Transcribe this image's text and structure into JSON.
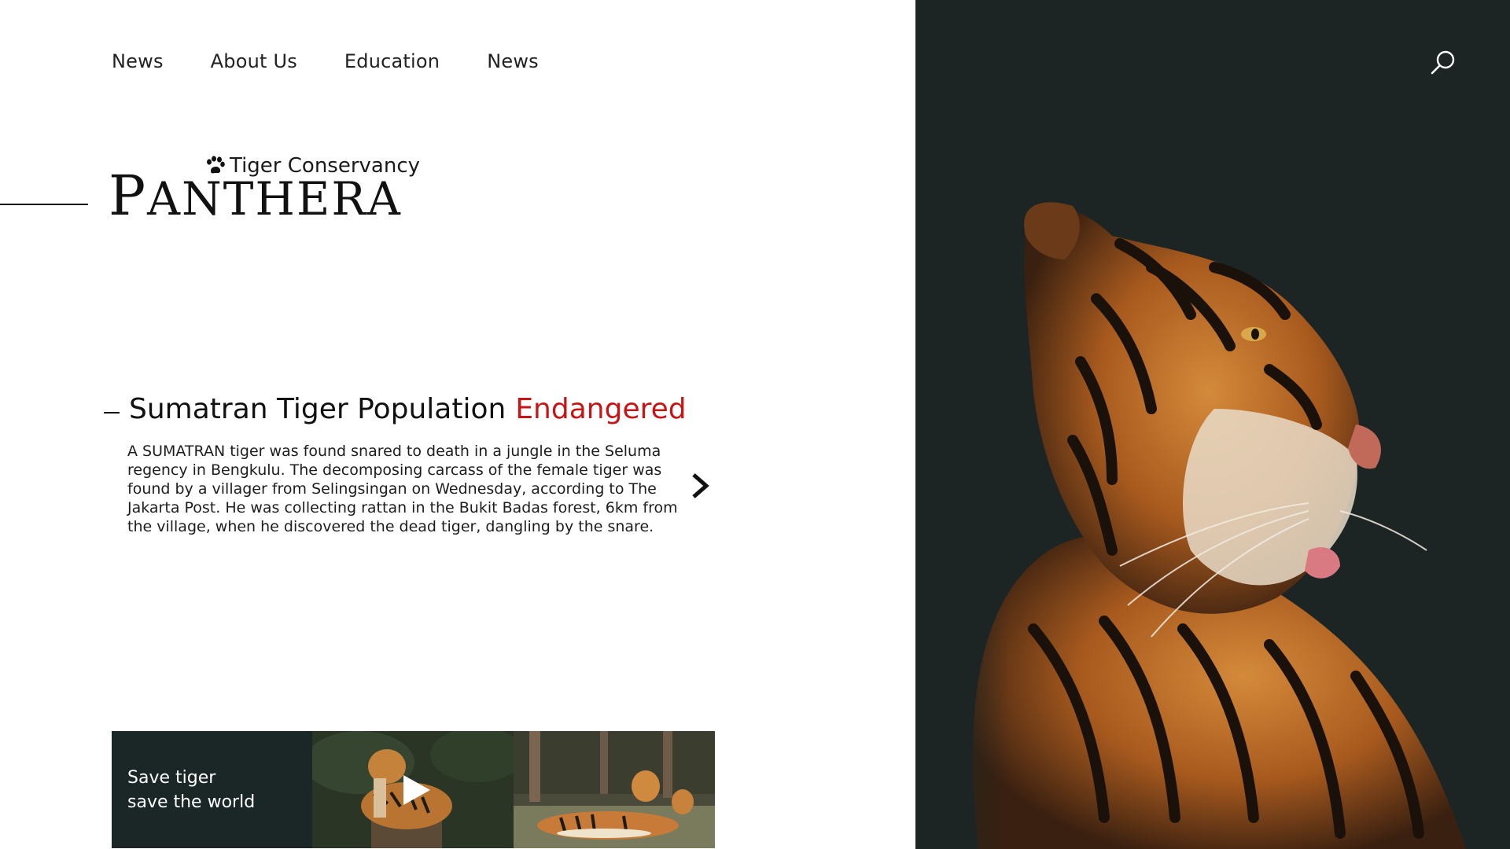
{
  "nav": {
    "items": [
      "News",
      "About Us",
      "Education",
      "News"
    ]
  },
  "brand": {
    "subtitle": "Tiger Conservancy",
    "title_initial": "P",
    "title_rest": "ANTHERA"
  },
  "feature": {
    "headline_main": "Sumatran Tiger Population",
    "headline_accent": "Endangered",
    "body": "A SUMATRAN tiger was found snared to death in a jungle in the Seluma regency in Bengkulu. The decomposing carcass of the female tiger was found by a villager from Selingsingan on Wednesday, according to The Jakarta Post. He was collecting rattan in the Bukit Badas forest, 6km from the village, when he discovered the dead tiger, dangling by the snare."
  },
  "promo": {
    "line1": "Save tiger",
    "line2": "save the world"
  },
  "colors": {
    "accent": "#c81414",
    "dark_panel": "#1d2524",
    "promo_bg": "#1b2726"
  },
  "icons": {
    "search": "search-icon",
    "paw": "paw-icon",
    "next": "chevron-right-icon",
    "play": "play-icon"
  }
}
